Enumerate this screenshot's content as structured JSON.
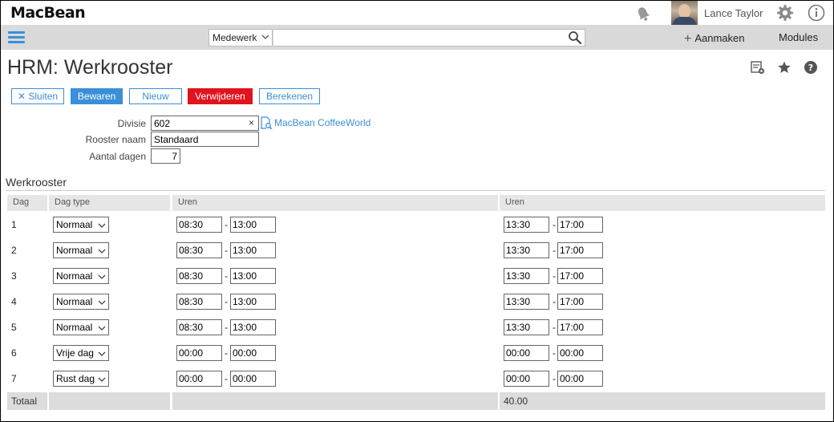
{
  "app": {
    "logo": "MacBean"
  },
  "user": {
    "name": "Lance Taylor"
  },
  "navbar": {
    "search_scope": "Medewerk",
    "search_value": "",
    "create_label": "Aanmaken",
    "modules_label": "Modules"
  },
  "page": {
    "title": "HRM: Werkrooster"
  },
  "toolbar": {
    "close_label": "Sluiten",
    "save_label": "Bewaren",
    "new_label": "Nieuw",
    "delete_label": "Verwijderen",
    "calculate_label": "Berekenen"
  },
  "form": {
    "divisie_label": "Divisie",
    "divisie_value": "602",
    "divisie_name": "MacBean CoffeeWorld",
    "rooster_label": "Rooster naam",
    "rooster_value": "Standaard",
    "dagen_label": "Aantal dagen",
    "dagen_value": "7"
  },
  "schedule": {
    "section_title": "Werkrooster",
    "headers": {
      "dag": "Dag",
      "dagtype": "Dag type",
      "uren1": "Uren",
      "uren2": "Uren"
    },
    "rows": [
      {
        "dag": "1",
        "type": "Normaal",
        "s1": "08:30",
        "e1": "13:00",
        "s2": "13:30",
        "e2": "17:00"
      },
      {
        "dag": "2",
        "type": "Normaal",
        "s1": "08:30",
        "e1": "13:00",
        "s2": "13:30",
        "e2": "17:00"
      },
      {
        "dag": "3",
        "type": "Normaal",
        "s1": "08:30",
        "e1": "13:00",
        "s2": "13:30",
        "e2": "17:00"
      },
      {
        "dag": "4",
        "type": "Normaal",
        "s1": "08:30",
        "e1": "13:00",
        "s2": "13:30",
        "e2": "17:00"
      },
      {
        "dag": "5",
        "type": "Normaal",
        "s1": "08:30",
        "e1": "13:00",
        "s2": "13:30",
        "e2": "17:00"
      },
      {
        "dag": "6",
        "type": "Vrije dag",
        "s1": "00:00",
        "e1": "00:00",
        "s2": "00:00",
        "e2": "00:00"
      },
      {
        "dag": "7",
        "type": "Rust dag",
        "s1": "00:00",
        "e1": "00:00",
        "s2": "00:00",
        "e2": "00:00"
      }
    ],
    "dash": "-",
    "total_label": "Totaal",
    "total_value": "40.00"
  },
  "colors": {
    "accent": "#3a8fd8",
    "danger": "#e0141e",
    "navbar": "#d9d9d9"
  },
  "icons": [
    "bell-icon",
    "gear-icon",
    "info-icon",
    "menu-icon",
    "search-icon",
    "report-icon",
    "star-icon",
    "help-icon",
    "close-icon",
    "lookup-icon",
    "chevron-down-icon"
  ]
}
